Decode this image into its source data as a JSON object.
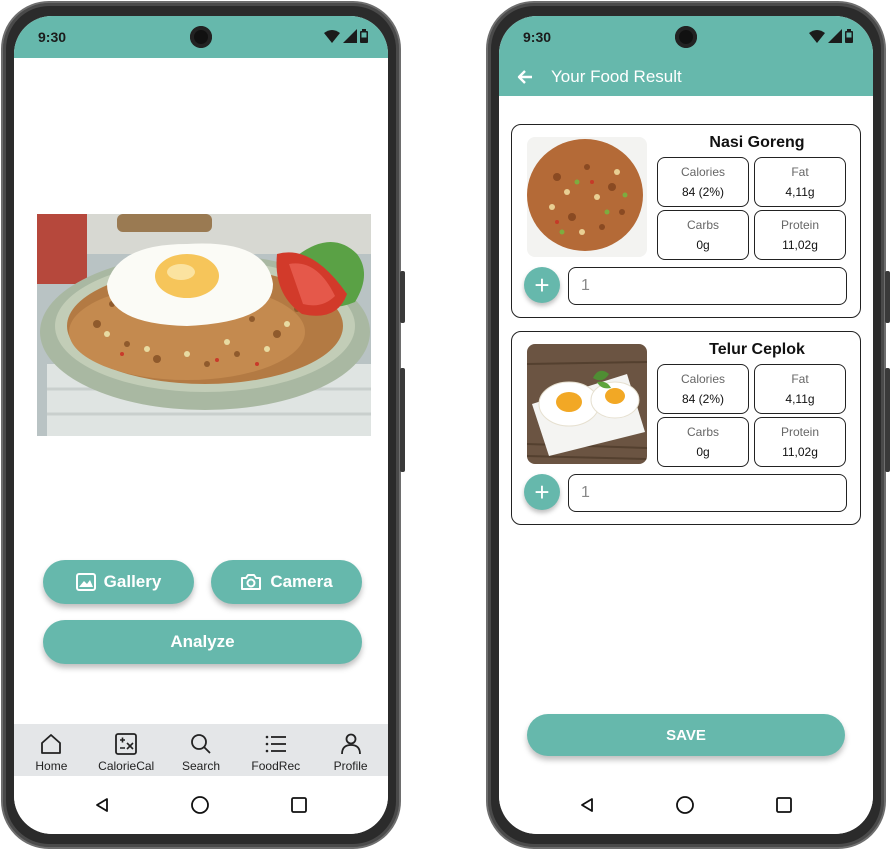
{
  "left_phone": {
    "status_time": "9:30",
    "buttons": {
      "gallery": "Gallery",
      "camera": "Camera",
      "analyze": "Analyze"
    },
    "nav": [
      {
        "label": "Home",
        "icon": "home-icon"
      },
      {
        "label": "CalorieCal",
        "icon": "calculator-icon"
      },
      {
        "label": "Search",
        "icon": "search-icon"
      },
      {
        "label": "FoodRec",
        "icon": "list-icon"
      },
      {
        "label": "Profile",
        "icon": "profile-icon"
      }
    ]
  },
  "right_phone": {
    "status_time": "9:30",
    "header_title": "Your Food Result",
    "foods": [
      {
        "name": "Nasi Goreng",
        "calories_label": "Calories",
        "calories": "84 (2%)",
        "fat_label": "Fat",
        "fat": "4,11g",
        "carbs_label": "Carbs",
        "carbs": "0g",
        "protein_label": "Protein",
        "protein": "11,02g",
        "quantity": "1"
      },
      {
        "name": "Telur Ceplok",
        "calories_label": "Calories",
        "calories": "84 (2%)",
        "fat_label": "Fat",
        "fat": "4,11g",
        "carbs_label": "Carbs",
        "carbs": "0g",
        "protein_label": "Protein",
        "protein": "11,02g",
        "quantity": "1"
      }
    ],
    "save_label": "SAVE"
  },
  "colors": {
    "accent": "#66b8ac",
    "nav_bg": "#e4e6e8"
  }
}
